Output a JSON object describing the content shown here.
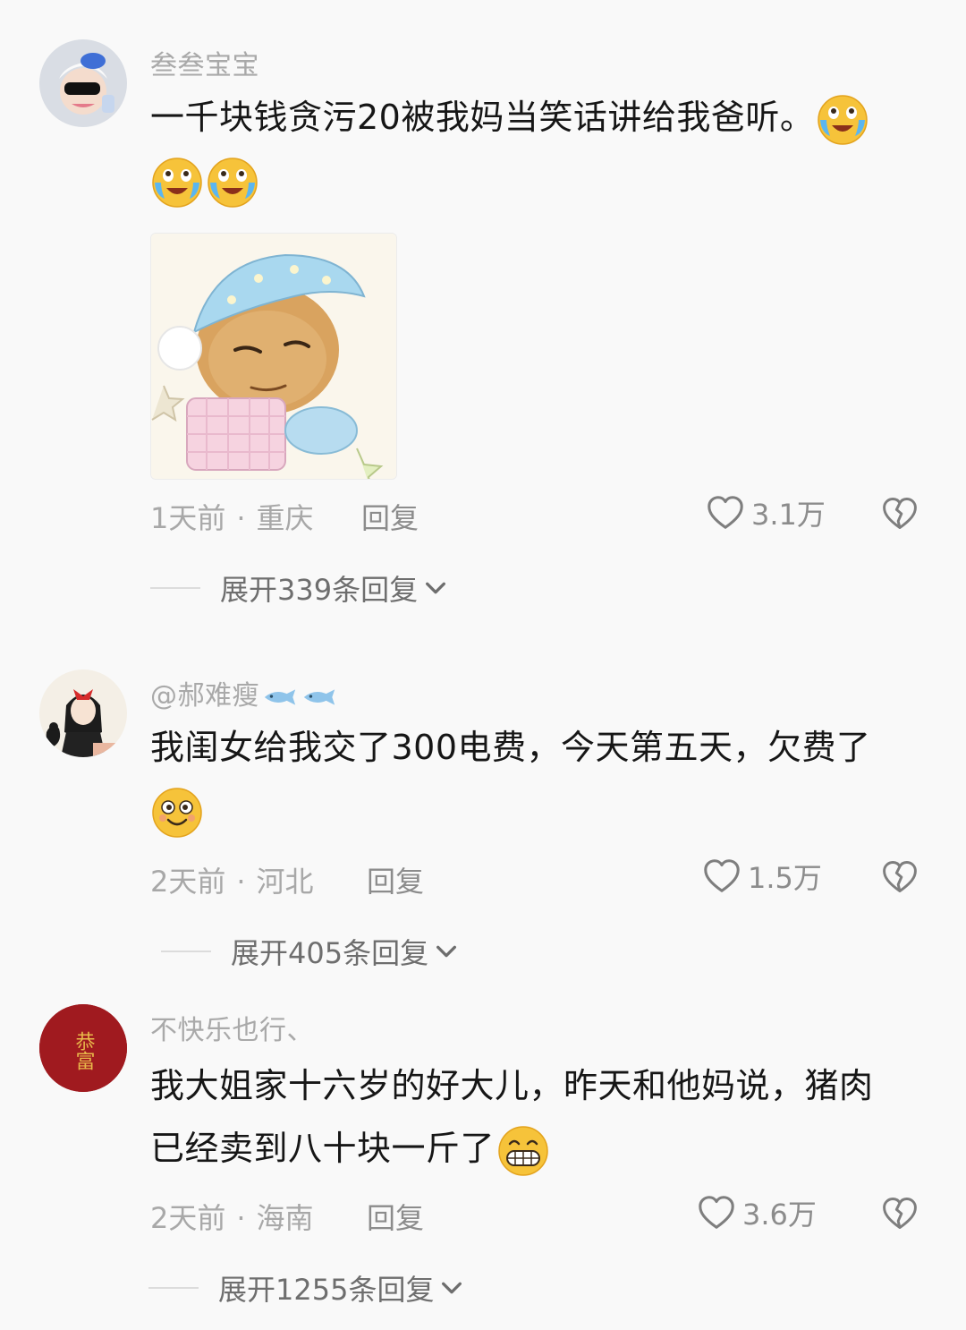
{
  "comments": [
    {
      "username": "叁叁宝宝",
      "text": "一千块钱贪污20被我妈当笑话讲给我爸听。",
      "time": "1天前",
      "location": "重庆",
      "reply_label": "回复",
      "likes": "3.1万",
      "expand_label": "展开339条回复",
      "emojis": [
        "crying-laughing-emoji",
        "crying-laughing-emoji",
        "crying-laughing-emoji"
      ],
      "sticker": "sleepy-nightcap-sticker"
    },
    {
      "username": "@郝难瘦",
      "badges": [
        "fish-icon",
        "fish-icon"
      ],
      "text": "我闺女给我交了300电费，今天第五天，欠费了",
      "time": "2天前",
      "location": "河北",
      "reply_label": "回复",
      "likes": "1.5万",
      "expand_label": "展开405条回复",
      "emojis": [
        "silly-face-emoji"
      ]
    },
    {
      "username": "不快乐也行、",
      "avatar_text": "恭富",
      "text_line1": "我大姐家十六岁的好大儿，昨天和他妈说，猪肉",
      "text_line2": "已经卖到八十块一斤了",
      "time": "2天前",
      "location": "海南",
      "reply_label": "回复",
      "likes": "3.6万",
      "expand_label": "展开1255条回复",
      "emojis": [
        "grin-emoji"
      ]
    }
  ],
  "colors": {
    "background": "#f9f9f9",
    "username": "#a9a9a9",
    "meta": "#a8a8a8",
    "action": "#8c8c8c",
    "avatar3_bg": "#a01a1f",
    "avatar3_text": "#e8b84a"
  }
}
